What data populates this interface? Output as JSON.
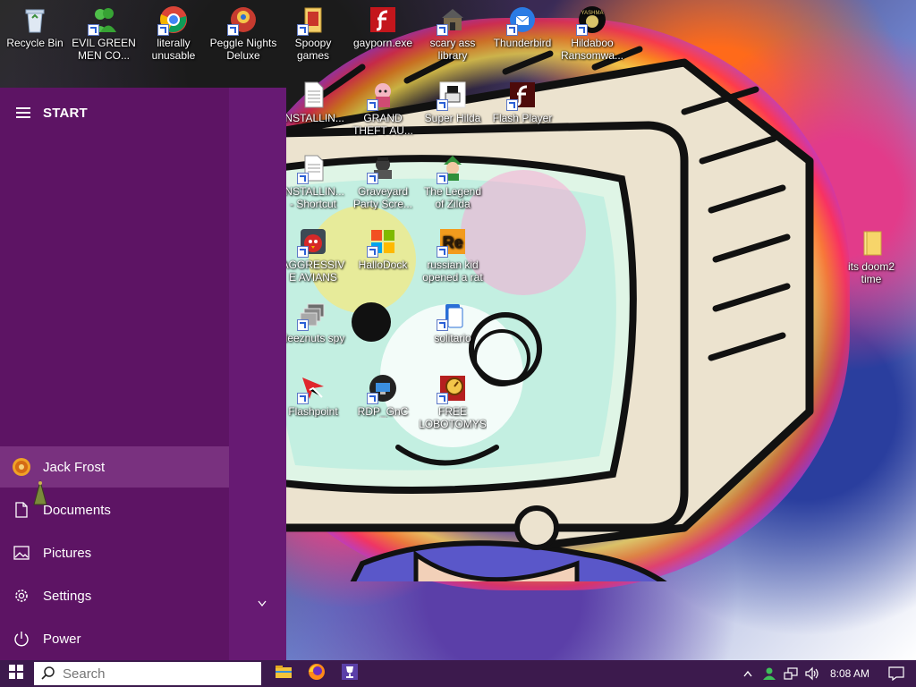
{
  "desktop": {
    "icons": [
      {
        "label": "Recycle Bin",
        "icon": "recycle-bin-icon"
      },
      {
        "label": "EVIL GREEN MEN CO...",
        "icon": "evil-green-men-icon"
      },
      {
        "label": "literally unusable",
        "icon": "chrome-icon"
      },
      {
        "label": "Peggle Nights Deluxe",
        "icon": "peggle-icon"
      },
      {
        "label": "Spoopy games",
        "icon": "folder-games-icon"
      },
      {
        "label": "gayporn.exe",
        "icon": "flash-icon"
      },
      {
        "label": "scary ass library",
        "icon": "library-icon"
      },
      {
        "label": "Thunderbird",
        "icon": "thunderbird-icon"
      },
      {
        "label": "Hildaboo Ransomwa...",
        "icon": "ransomware-icon"
      },
      {
        "label": "INSTALLIN...",
        "icon": "text-document-icon"
      },
      {
        "label": "GRAND THEFT AU...",
        "icon": "gta-icon"
      },
      {
        "label": "Super Hilda",
        "icon": "super-hilda-icon"
      },
      {
        "label": "Flash Player",
        "icon": "flash-player-icon"
      },
      {
        "label": "INSTALLIN... - Shortcut",
        "icon": "text-document-icon"
      },
      {
        "label": "Graveyard Party Scre...",
        "icon": "graveyard-icon"
      },
      {
        "label": "The Legend of Zilda",
        "icon": "zilda-icon"
      },
      {
        "label": "AGGRESSIVE AVIANS",
        "icon": "angry-bird-icon"
      },
      {
        "label": "HalloDock",
        "icon": "windows-shield-icon"
      },
      {
        "label": "russian kid opened a rat",
        "icon": "russian-kid-icon"
      },
      {
        "label": "deeznuts spy",
        "icon": "window-stack-icon"
      },
      {
        "label": "solitario",
        "icon": "solitaire-icon"
      },
      {
        "label": "Flashpoint",
        "icon": "flashpoint-icon"
      },
      {
        "label": "RDP_GnC",
        "icon": "rdp-icon"
      },
      {
        "label": "FREE LOBOTOMYS",
        "icon": "lobotomy-icon"
      },
      {
        "label": "its doom2 time",
        "icon": "folder-icon"
      }
    ]
  },
  "start_menu": {
    "title": "START",
    "items": [
      {
        "label": "Jack Frost",
        "icon": "user-avatar-icon"
      },
      {
        "label": "Documents",
        "icon": "document-icon"
      },
      {
        "label": "Pictures",
        "icon": "pictures-icon"
      },
      {
        "label": "Settings",
        "icon": "gear-icon"
      },
      {
        "label": "Power",
        "icon": "power-icon"
      }
    ],
    "colors": {
      "rail": "#5d1464",
      "tiles": "#671a73",
      "hover": "#79317f"
    }
  },
  "taskbar": {
    "search": {
      "placeholder": "Search",
      "value": ""
    },
    "apps": [
      "file-explorer-icon",
      "firefox-icon",
      "trophy-app-icon"
    ],
    "tray": {
      "icons": [
        "chevron-up-icon",
        "people-icon",
        "network-icon",
        "volume-icon"
      ],
      "time": "8:08 AM"
    },
    "color": "#3c1a4d"
  }
}
